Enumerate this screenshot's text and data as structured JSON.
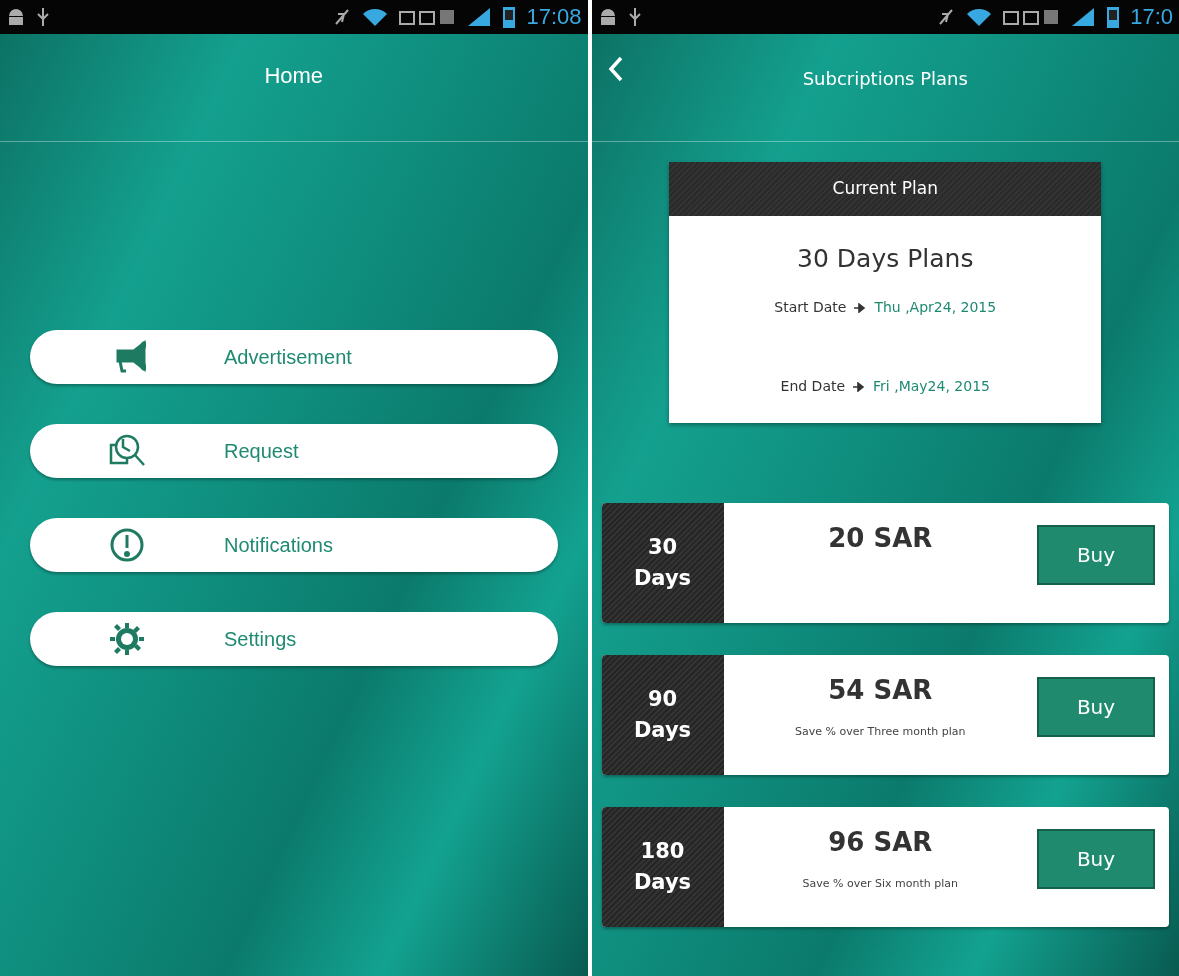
{
  "screens": [
    {
      "kind": "home",
      "status_bar": {
        "time": "17:08"
      },
      "title": "Home",
      "menu": [
        {
          "kind": "megaphone",
          "label": "Advertisement"
        },
        {
          "kind": "search-document",
          "label": "Request"
        },
        {
          "kind": "alert",
          "label": "Notifications"
        },
        {
          "kind": "gear",
          "label": "Settings"
        }
      ]
    },
    {
      "kind": "plans",
      "status_bar": {
        "time": "17:0"
      },
      "title": "Subcriptions Plans",
      "current_plan": {
        "header": "Current Plan",
        "name": "30 Days Plans",
        "dates": [
          {
            "label": "Start Date",
            "value": "Thu ,Apr24, 2015"
          },
          {
            "label": "End Date",
            "value": "Fri ,May24, 2015"
          }
        ]
      },
      "plans": [
        {
          "days": "30",
          "unit": "Days",
          "price": "20 SAR",
          "button": "Buy"
        },
        {
          "days": "90",
          "unit": "Days",
          "price": "54 SAR",
          "note": "Save % over Three month plan",
          "button": "Buy"
        },
        {
          "days": "180",
          "unit": "Days",
          "price": "96 SAR",
          "note": "Save % over Six month plan",
          "button": "Buy"
        }
      ]
    }
  ]
}
